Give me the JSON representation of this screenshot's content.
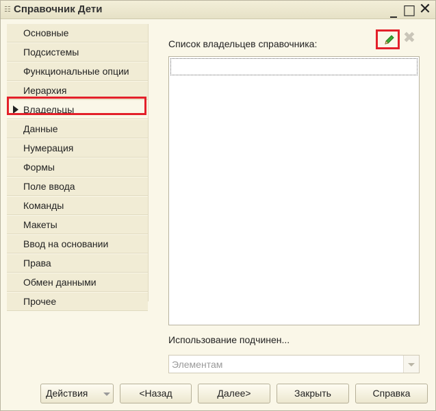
{
  "window": {
    "title": "Справочник Дети",
    "icon": "catalog-icon"
  },
  "nav": {
    "items": [
      {
        "label": "Основные"
      },
      {
        "label": "Подсистемы"
      },
      {
        "label": "Функциональные опции"
      },
      {
        "label": "Иерархия"
      },
      {
        "label": "Владельцы",
        "active": true
      },
      {
        "label": "Данные"
      },
      {
        "label": "Нумерация"
      },
      {
        "label": "Формы"
      },
      {
        "label": "Поле ввода"
      },
      {
        "label": "Команды"
      },
      {
        "label": "Макеты"
      },
      {
        "label": "Ввод на основании"
      },
      {
        "label": "Права"
      },
      {
        "label": "Обмен данными"
      },
      {
        "label": "Прочее"
      }
    ]
  },
  "owners": {
    "list_label": "Список владельцев справочника:",
    "edit_icon": "pencil-icon",
    "delete_icon": "delete-icon",
    "rows": []
  },
  "usage": {
    "label": "Использование подчинен...",
    "value": "Элементам"
  },
  "buttons": {
    "actions": "Действия",
    "back": "<Назад",
    "next": "Далее>",
    "close": "Закрыть",
    "help": "Справка"
  },
  "colors": {
    "highlight": "#e3202a",
    "background": "#faf7e8",
    "nav_item": "#f1ecd5"
  }
}
